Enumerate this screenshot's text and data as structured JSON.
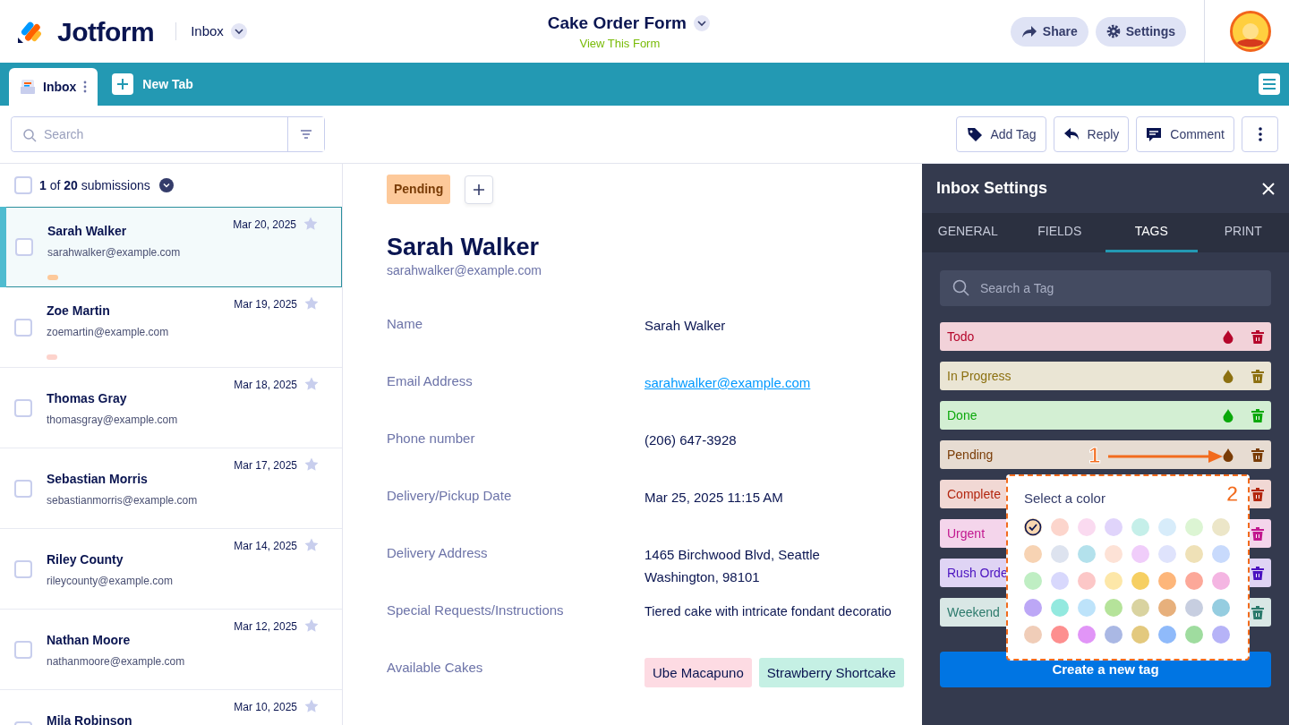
{
  "header": {
    "brand": "Jotform",
    "section": "Inbox",
    "form_title": "Cake Order Form",
    "form_link": "View This Form",
    "buttons": [
      {
        "label": "Share",
        "kind": "share"
      },
      {
        "label": "Settings",
        "kind": "settings"
      }
    ]
  },
  "tabs": [
    {
      "label": "Inbox",
      "selected": true
    }
  ],
  "new_tab_button": {
    "label": "New Tab"
  },
  "toolbar": {
    "search": {
      "placeholder": "Search"
    },
    "actions": [
      {
        "label": "Add Tag",
        "kind": "tag"
      },
      {
        "label": "Reply",
        "kind": "reply"
      },
      {
        "label": "Comment",
        "kind": "comment"
      }
    ]
  },
  "submissions": {
    "all_checked": false,
    "count": "**1** of **20** submissions",
    "items": [
      {
        "name": "Sarah Walker",
        "email": "sarahwalker@example.com",
        "date": "Mar 20, 2025",
        "checked": false,
        "selected": true,
        "starred": false,
        "tags": [
          {
            "color": "#fdc99a"
          }
        ]
      },
      {
        "name": "Zoe Martin",
        "email": "zoemartin@example.com",
        "date": "Mar 19, 2025",
        "checked": false,
        "selected": false,
        "starred": false,
        "tags": [
          {
            "color": "#fdd3cc"
          }
        ]
      },
      {
        "name": "Thomas Gray",
        "email": "thomasgray@example.com",
        "date": "Mar 18, 2025",
        "checked": false,
        "selected": false,
        "starred": false
      },
      {
        "name": "Sebastian Morris",
        "email": "sebastianmorris@example.com",
        "date": "Mar 17, 2025",
        "checked": false,
        "selected": false,
        "starred": false
      },
      {
        "name": "Riley County",
        "email": "rileycounty@example.com",
        "date": "Mar 14, 2025",
        "checked": false,
        "selected": false,
        "starred": false
      },
      {
        "name": "Nathan Moore",
        "email": "nathanmoore@example.com",
        "date": "Mar 12, 2025",
        "checked": false,
        "selected": false,
        "starred": false
      },
      {
        "name": "Mila Robinson",
        "date": "Mar 10, 2025",
        "checked": false,
        "selected": false,
        "starred": false
      }
    ]
  },
  "detail": {
    "tags": [
      {
        "label": "Pending",
        "color": "#fdc99a"
      }
    ],
    "name": "Sarah Walker",
    "email": "sarahwalker@example.com",
    "fields": [
      {
        "label": "Name",
        "kind": "text",
        "value": "Sarah Walker"
      },
      {
        "label": "Email Address",
        "kind": "link",
        "value": "sarahwalker@example.com"
      },
      {
        "label": "Phone number",
        "kind": "text",
        "value": "(206) 647-3928"
      },
      {
        "label": "Delivery/Pickup Date",
        "kind": "text",
        "value": "Mar 25, 2025 11:15 AM"
      },
      {
        "label": "Delivery Address",
        "kind": "lines",
        "lines": [
          "1465 Birchwood Blvd, Seattle",
          "Washington, 98101"
        ]
      },
      {
        "label": "Special Requests/Instructions",
        "kind": "text",
        "value": "Tiered cake with intricate fondant decoratio"
      },
      {
        "label": "Available Cakes",
        "kind": "chips",
        "chips": [
          {
            "label": "Ube Macapuno",
            "color": "#fddbe3"
          },
          {
            "label": "Strawberry Shortcake",
            "color": "#c5f0e4"
          }
        ]
      }
    ]
  },
  "settings_panel": {
    "title": "Inbox Settings",
    "tabs": [
      {
        "label": "GENERAL",
        "selected": false
      },
      {
        "label": "FIELDS",
        "selected": false
      },
      {
        "label": "TAGS",
        "selected": true
      },
      {
        "label": "PRINT",
        "selected": false
      }
    ],
    "search": {
      "placeholder": "Search a Tag"
    },
    "tags": [
      {
        "label": "Todo",
        "color": "#b5062b"
      },
      {
        "label": "In Progress",
        "color": "#8c7010"
      },
      {
        "label": "Done",
        "color": "#0aa80a"
      },
      {
        "label": "Pending",
        "color": "#7a3c06"
      },
      {
        "label": "Complete",
        "color": "#b3260f"
      },
      {
        "label": "Urgent",
        "color": "#c2188f"
      },
      {
        "label": "Rush Orde",
        "color": "#4b12c0"
      },
      {
        "label": "Weekend",
        "color": "#2c7a6c"
      }
    ],
    "create_button": "Create a new tag"
  },
  "color_picker": {
    "title": "Select a color",
    "swatches": [
      {
        "color": "#f8d6b0",
        "selected": true
      },
      {
        "color": "#fcd5cc",
        "selected": false
      },
      {
        "color": "#fadaf0",
        "selected": false
      },
      {
        "color": "#e0d4fb",
        "selected": false
      },
      {
        "color": "#c5efe9",
        "selected": false
      },
      {
        "color": "#d7ecfa",
        "selected": false
      },
      {
        "color": "#dcf5d3",
        "selected": false
      },
      {
        "color": "#ece6c8",
        "selected": false
      },
      {
        "color": "#f7d3b3",
        "selected": false
      },
      {
        "color": "#dde3ef",
        "selected": false
      },
      {
        "color": "#b3e1ec",
        "selected": false
      },
      {
        "color": "#fde2d6",
        "selected": false
      },
      {
        "color": "#f0cdfa",
        "selected": false
      },
      {
        "color": "#dfe3fc",
        "selected": false
      },
      {
        "color": "#efe1b7",
        "selected": false
      },
      {
        "color": "#c8dafc",
        "selected": false
      },
      {
        "color": "#bfeec3",
        "selected": false
      },
      {
        "color": "#d8d8fc",
        "selected": false
      },
      {
        "color": "#fcc7c7",
        "selected": false
      },
      {
        "color": "#fde7a8",
        "selected": false
      },
      {
        "color": "#f6cf62",
        "selected": false
      },
      {
        "color": "#fdb67a",
        "selected": false
      },
      {
        "color": "#fca899",
        "selected": false
      },
      {
        "color": "#f4b5e2",
        "selected": false
      },
      {
        "color": "#bca7f6",
        "selected": false
      },
      {
        "color": "#93e9df",
        "selected": false
      },
      {
        "color": "#bde3fa",
        "selected": false
      },
      {
        "color": "#b5e39a",
        "selected": false
      },
      {
        "color": "#d9d3a0",
        "selected": false
      },
      {
        "color": "#e7b07c",
        "selected": false
      },
      {
        "color": "#c7cee0",
        "selected": false
      },
      {
        "color": "#95cde0",
        "selected": false
      },
      {
        "color": "#f0cdb8",
        "selected": false
      },
      {
        "color": "#fd8f8f",
        "selected": false
      },
      {
        "color": "#e195f7",
        "selected": false
      },
      {
        "color": "#aab8e4",
        "selected": false
      },
      {
        "color": "#e3c97e",
        "selected": false
      },
      {
        "color": "#8fbafa",
        "selected": false
      },
      {
        "color": "#9fdc9f",
        "selected": false
      },
      {
        "color": "#b6b3f7",
        "selected": false
      }
    ]
  },
  "annotations": [
    {
      "label": "1"
    },
    {
      "label": "2"
    }
  ]
}
